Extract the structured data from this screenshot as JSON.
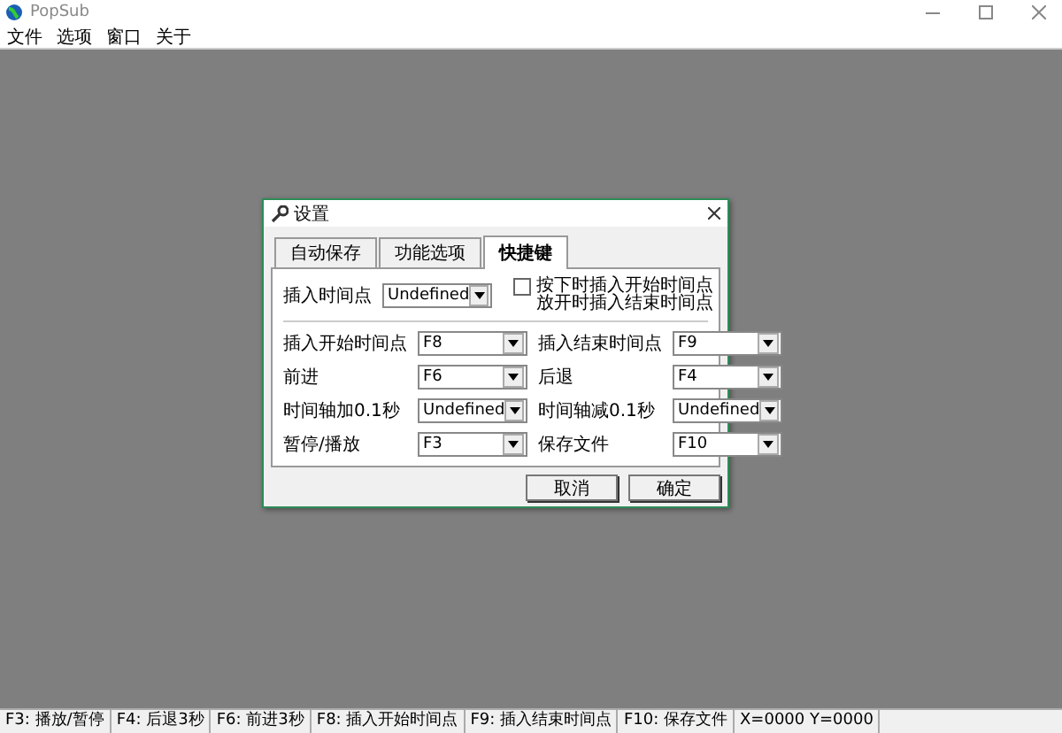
{
  "window": {
    "title": "PopSub"
  },
  "menu": [
    "文件",
    "选项",
    "窗口",
    "关于"
  ],
  "dialog": {
    "title": "设置",
    "tabs": [
      {
        "label": "自动保存",
        "selected": false
      },
      {
        "label": "功能选项",
        "selected": false
      },
      {
        "label": "快捷键",
        "selected": true
      }
    ],
    "insert_point": {
      "label": "插入时间点",
      "value": "Undefined"
    },
    "hold_option": {
      "label": "按下时插入开始时间点放开时插入结束时间点",
      "checked": false
    },
    "shortcuts": [
      {
        "label": "插入开始时间点",
        "value": "F8"
      },
      {
        "label": "插入结束时间点",
        "value": "F9"
      },
      {
        "label": "前进",
        "value": "F6"
      },
      {
        "label": "后退",
        "value": "F4"
      },
      {
        "label": "时间轴加0.1秒",
        "value": "Undefined"
      },
      {
        "label": "时间轴减0.1秒",
        "value": "Undefined"
      },
      {
        "label": "暂停/播放",
        "value": "F3"
      },
      {
        "label": "保存文件",
        "value": "F10"
      }
    ],
    "buttons": [
      "取消",
      "确定"
    ]
  },
  "status_bar": [
    "F3: 播放/暂停",
    "F4: 后退3秒",
    "F6: 前进3秒",
    "F8: 插入开始时间点",
    "F9: 插入结束时间点",
    "F10: 保存文件",
    "X=0000 Y=0000"
  ]
}
